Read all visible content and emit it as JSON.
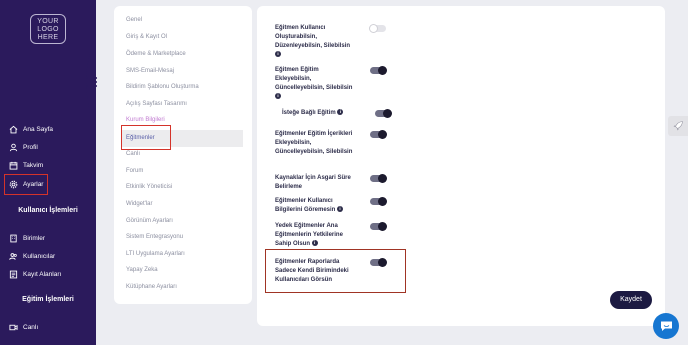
{
  "sidebar": {
    "logo_text": [
      "YOUR",
      "LOGO",
      "HERE"
    ],
    "items": [
      {
        "label": "Ana Sayfa",
        "icon": "home-icon"
      },
      {
        "label": "Profil",
        "icon": "user-icon"
      },
      {
        "label": "Takvim",
        "icon": "calendar-icon"
      },
      {
        "label": "Ayarlar",
        "icon": "gear-icon"
      }
    ],
    "section_user": "Kullanıcı İşlemleri",
    "user_items": [
      {
        "label": "Birimler",
        "icon": "building-icon"
      },
      {
        "label": "Kullanıcılar",
        "icon": "users-icon"
      },
      {
        "label": "Kayıt Alanları",
        "icon": "form-icon"
      }
    ],
    "section_education": "Eğitim İşlemleri",
    "education_items": [
      {
        "label": "Canlı",
        "icon": "video-icon"
      }
    ]
  },
  "settings_menu": {
    "items": [
      "Genel",
      "Giriş & Kayıt Ol",
      "Ödeme & Marketplace",
      "SMS-Email-Mesaj",
      "Bildirim Şablonu Oluşturma",
      "Açılış Sayfası Tasarımı",
      "Kurum Bilgileri",
      "Eğitmenler",
      "Canlı",
      "Forum",
      "Etkinlik Yöneticisi",
      "Widget'lar",
      "Görünüm Ayarları",
      "Sistem Entegrasyonu",
      "LTI Uygulama Ayarları",
      "Yapay Zeka",
      "Kütüphane Ayarları"
    ],
    "active": "Eğitmenler"
  },
  "settings": [
    {
      "lines": [
        "Eğitmen Kullanıcı",
        "Oluşturabilsin,",
        "Düzenleyebilsin, Silebilsin"
      ],
      "info": true,
      "enabled": false
    },
    {
      "lines": [
        "Eğitmen Eğitim",
        "Ekleyebilsin,",
        "Güncelleyebilsin, Silebilsin"
      ],
      "info": true,
      "enabled": true
    },
    {
      "lines": [
        "İsteğe Bağlı Eğitim"
      ],
      "info": true,
      "enabled": true
    },
    {
      "lines": [
        "Eğitmenler Eğitim İçerikleri",
        "Ekleyebilsin,",
        "Güncelleyebilsin, Silebilsin"
      ],
      "info": true,
      "enabled": true
    },
    {
      "lines": [
        "Kaynaklar İçin Asgari Süre",
        "Belirleme"
      ],
      "info": false,
      "enabled": true
    },
    {
      "lines": [
        "Eğitmenler Kullanıcı",
        "Bilgilerini Göremesin"
      ],
      "info": true,
      "enabled": true
    },
    {
      "lines": [
        "Yedek Eğitmenler Ana",
        "Eğitmenlerin Yetkilerine",
        "Sahip Olsun"
      ],
      "info": true,
      "enabled": true
    },
    {
      "lines": [
        "Eğitmenler Raporlarda",
        "Sadece Kendi Birimindeki",
        "Kullanıcıları Görsün"
      ],
      "info": false,
      "enabled": true
    }
  ],
  "save_label": "Kaydet",
  "info_glyph": "i",
  "colors": {
    "sidebar_bg": "#2b1a5c",
    "accent_highlight": "#d4332a",
    "toggle_on": "#1c1a2e",
    "save_button": "#1c1a42",
    "chat_button": "#1676d1"
  }
}
